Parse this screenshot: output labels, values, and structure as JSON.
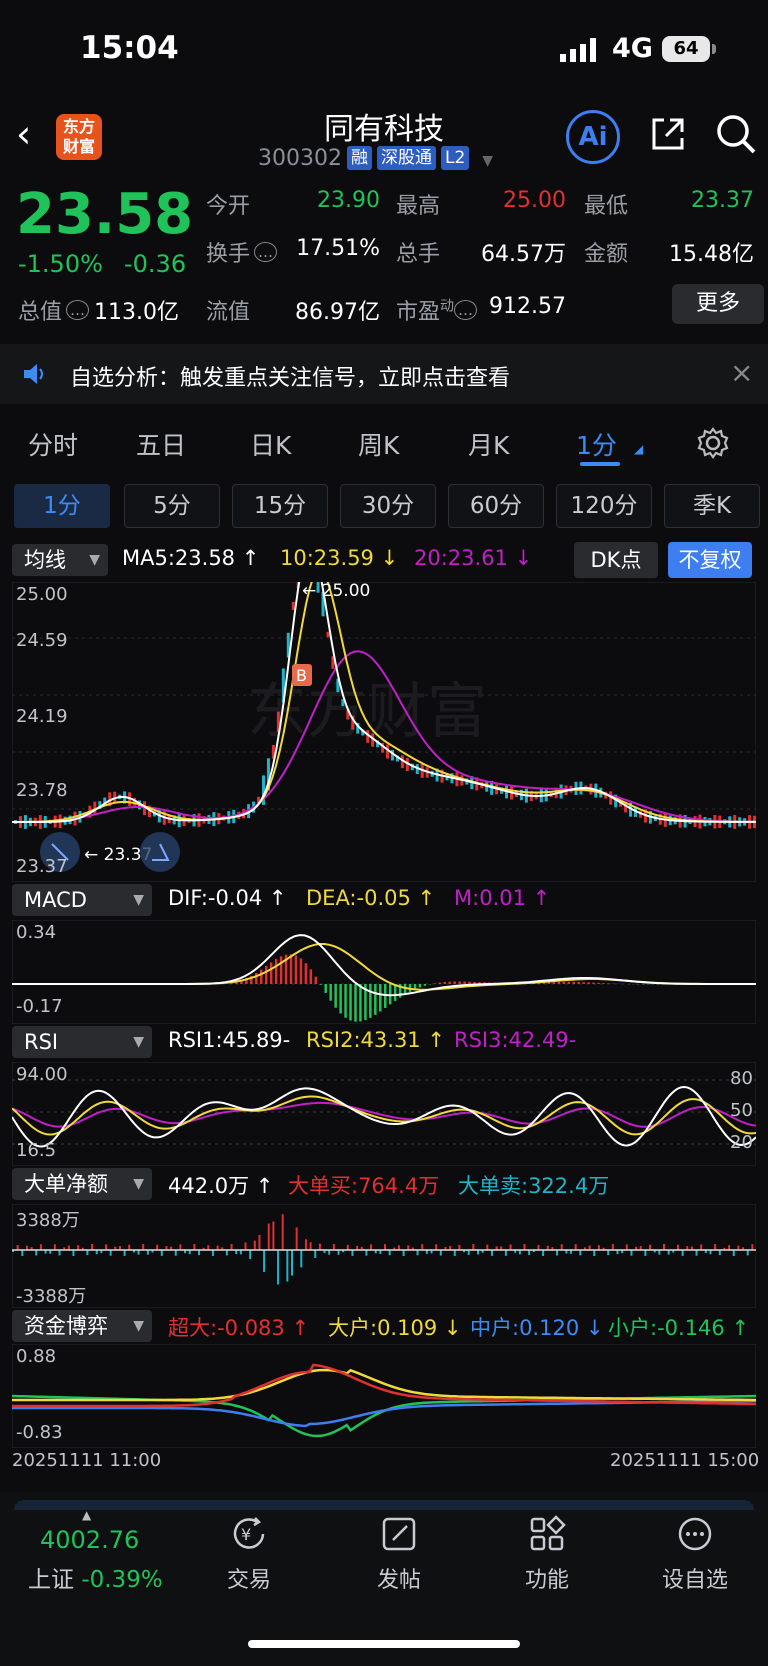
{
  "status_bar": {
    "time": "15:04",
    "network": "4G",
    "battery": "64"
  },
  "header": {
    "logo": "东方财富",
    "stock_name": "同有科技",
    "stock_code": "300302",
    "tags": [
      "融",
      "深股通",
      "L2"
    ],
    "ai_label": "Ai"
  },
  "quote": {
    "price": "23.58",
    "change_pct": "-1.50%",
    "change": "-0.36",
    "open_label": "今开",
    "open": "23.90",
    "high_label": "最高",
    "high": "25.00",
    "low_label": "最低",
    "low": "23.37",
    "turnover_label": "换手",
    "turnover": "17.51%",
    "volume_label": "总手",
    "volume": "64.57万",
    "amount_label": "金额",
    "amount": "15.48亿",
    "mktcap_label": "总值",
    "mktcap": "113.0亿",
    "float_label": "流值",
    "float": "86.97亿",
    "pe_label": "市盈",
    "pe_sup": "动",
    "pe": "912.57",
    "more": "更多"
  },
  "notice": {
    "text": "自选分析：触发重点关注信号，立即点击查看"
  },
  "tabs": [
    "分时",
    "五日",
    "日K",
    "周K",
    "月K",
    "1分"
  ],
  "periods": [
    "1分",
    "5分",
    "15分",
    "30分",
    "60分",
    "120分",
    "季K"
  ],
  "main_chart": {
    "indicator": "均线",
    "ma5": "MA5:23.58",
    "ma10": "10:23.59",
    "ma20": "20:23.61",
    "dk": "DK点",
    "fq": "不复权",
    "y_labels": [
      "25.00",
      "24.59",
      "24.19",
      "23.78",
      "23.37"
    ],
    "high_marker": "25.00",
    "low_marker": "23.37",
    "buy_marker": "B",
    "colors": {
      "ma5": "#ffffff",
      "ma10": "#f0d93c",
      "ma20": "#c020c8",
      "up": "#e03030",
      "down": "#1fb5c8"
    }
  },
  "macd": {
    "indicator": "MACD",
    "dif": "DIF:-0.04",
    "dea": "DEA:-0.05",
    "m": "M:0.01",
    "y_labels": [
      "0.34",
      "-0.17"
    ]
  },
  "rsi": {
    "indicator": "RSI",
    "rsi1": "RSI1:45.89-",
    "rsi2": "RSI2:43.31",
    "rsi3": "RSI3:42.49-",
    "y_labels": [
      "94.00",
      "16.5"
    ],
    "right_labels": [
      "80",
      "50",
      "20"
    ]
  },
  "big_order": {
    "indicator": "大单净额",
    "net": "442.0万",
    "buy": "大单买:764.4万",
    "sell": "大单卖:322.4万",
    "y_labels": [
      "3388万",
      "-3388万"
    ]
  },
  "fund": {
    "indicator": "资金博弈",
    "super": "超大:-0.083",
    "large": "大户:0.109",
    "mid": "中户:0.120",
    "small": "小户:-0.146",
    "y_labels": [
      "0.88",
      "-0.83"
    ],
    "x_start": "20251111 11:00",
    "x_end": "20251111 15:00"
  },
  "bottom_bar": {
    "index_value": "4002.76",
    "index_name": "上证",
    "index_change": "-0.39%",
    "items": [
      "交易",
      "发帖",
      "功能",
      "设自选"
    ]
  }
}
